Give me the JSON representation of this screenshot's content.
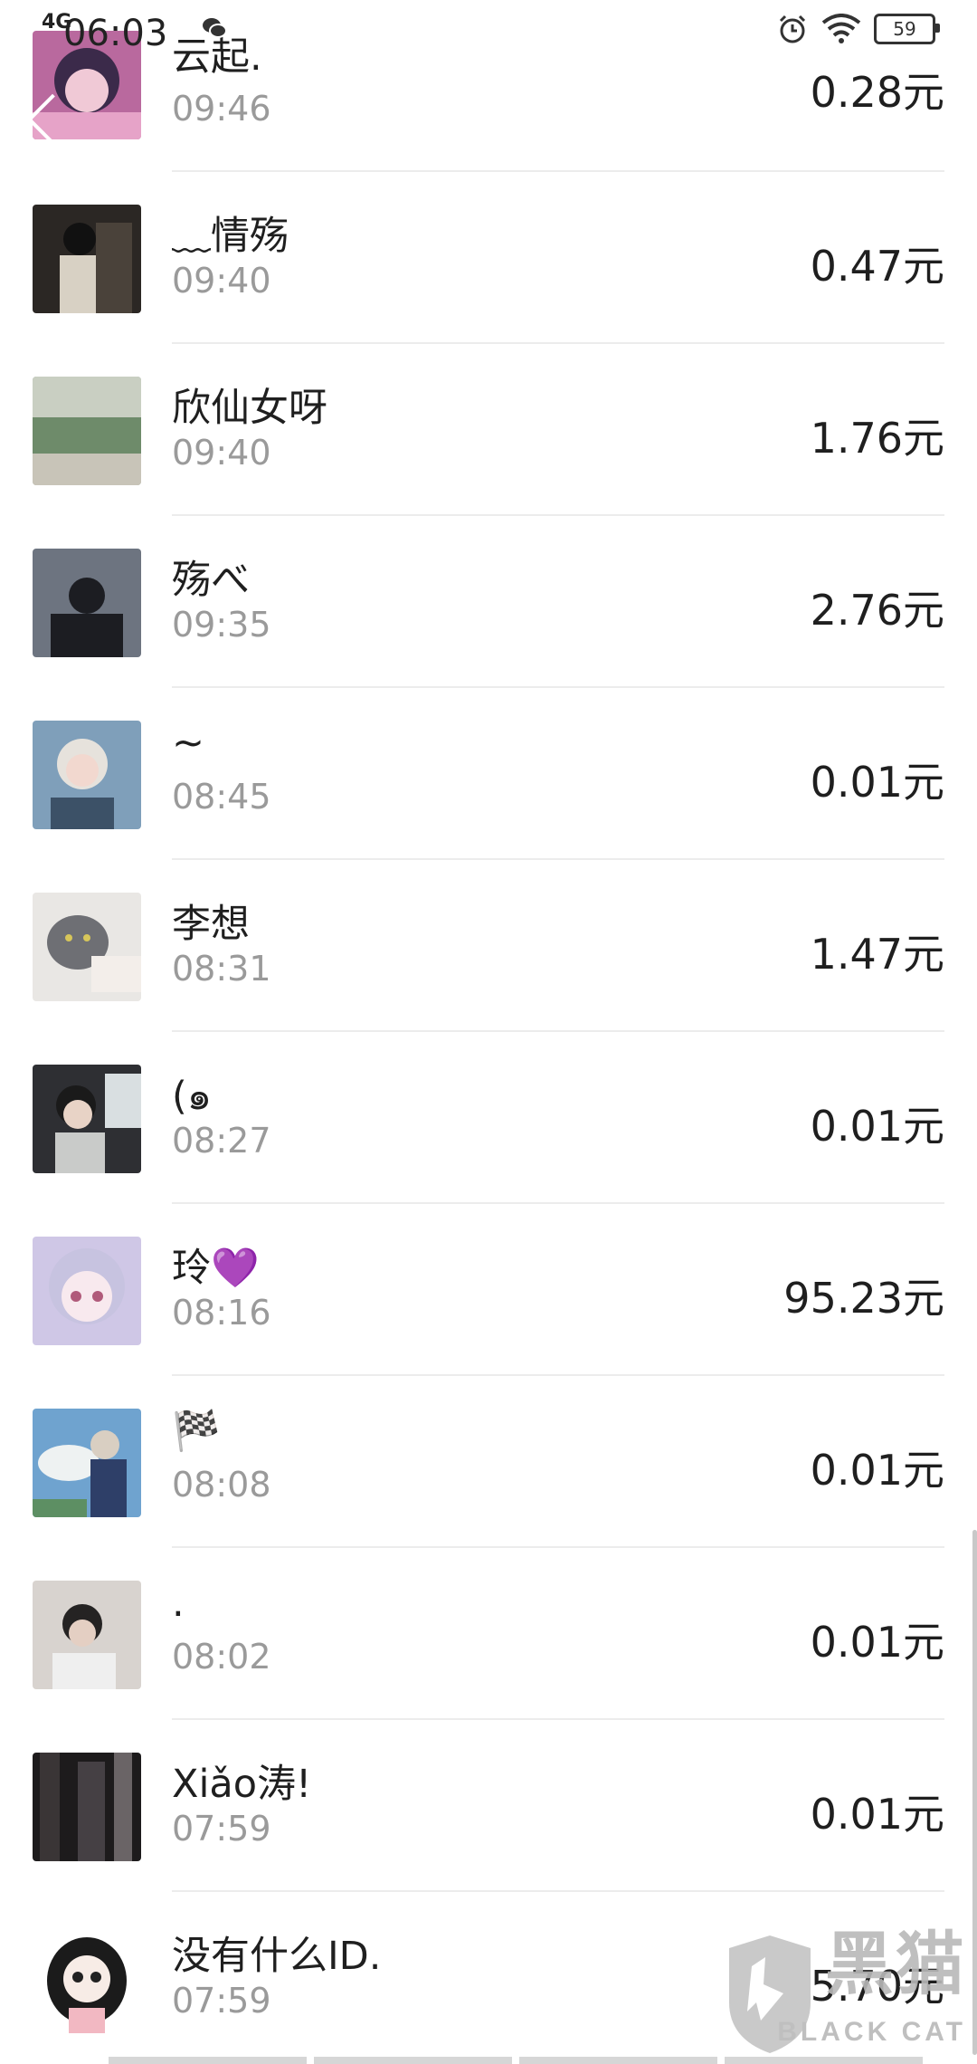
{
  "status_bar": {
    "network": "4G",
    "time": "06:03",
    "battery": "59",
    "icons": [
      "wechat-icon",
      "alarm-icon",
      "wifi-icon",
      "battery-icon"
    ]
  },
  "records": [
    {
      "name": "云起.",
      "time": "09:46",
      "amount": "0.28元"
    },
    {
      "name": "﹏情殇",
      "time": "09:40",
      "amount": "0.47元"
    },
    {
      "name": "欣仙女呀",
      "time": "09:40",
      "amount": "1.76元"
    },
    {
      "name": "殇べ",
      "time": "09:35",
      "amount": "2.76元"
    },
    {
      "name": "~",
      "time": "08:45",
      "amount": "0.01元"
    },
    {
      "name": "李想",
      "time": "08:31",
      "amount": "1.47元"
    },
    {
      "name": "(๑",
      "time": "08:27",
      "amount": "0.01元"
    },
    {
      "name": "玲💜",
      "time": "08:16",
      "amount": "95.23元"
    },
    {
      "name": "🏁",
      "time": "08:08",
      "amount": "0.01元"
    },
    {
      "name": "  .",
      "time": "08:02",
      "amount": "0.01元"
    },
    {
      "name": "Xiǎo涛!",
      "time": "07:59",
      "amount": "0.01元"
    },
    {
      "name": "没有什么ID.",
      "time": "07:59",
      "amount": "5.70元"
    }
  ],
  "watermark": {
    "cn": "黑猫",
    "en": "BLACK CAT"
  }
}
